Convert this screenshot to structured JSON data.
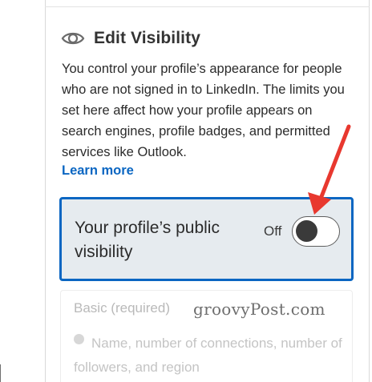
{
  "section": {
    "heading": "Edit Visibility",
    "eye_icon": "eye-icon",
    "description": "You control your profile’s appearance for people who are not signed in to LinkedIn. The limits you set here affect how your profile appears on search engines, profile badges, and permitted services like Outlook.",
    "learn_more": "Learn more"
  },
  "public_visibility": {
    "label": "Your profile’s public visibility",
    "state_text": "Off",
    "enabled": false
  },
  "basic": {
    "title": "Basic (required)",
    "option_text": "Name, number of connections, number of followers, and region"
  },
  "watermark": "groovyPost.com",
  "colors": {
    "accent": "#0a66c2",
    "card_background": "#e6ebef",
    "annotation_arrow": "#e8382f"
  }
}
